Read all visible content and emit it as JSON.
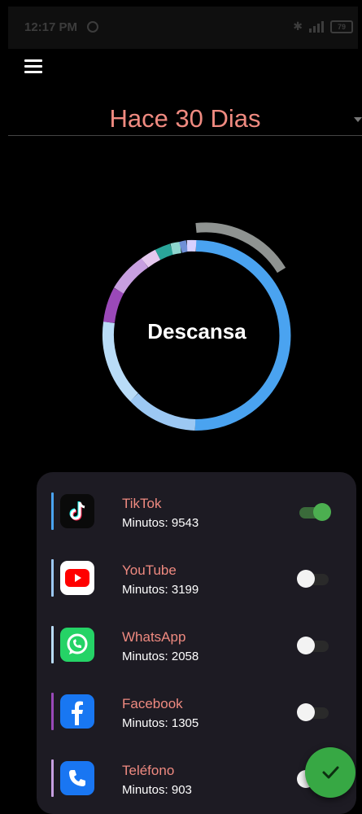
{
  "status_bar": {
    "time": "12:17 PM",
    "battery": "79"
  },
  "header": {
    "menu_icon": "hamburger-menu-icon"
  },
  "range_selector": {
    "label": "Hace 30 Dias"
  },
  "donut": {
    "center_label": "Descansa"
  },
  "apps": [
    {
      "name": "TikTok",
      "minutes": "Minutos: 9543",
      "enabled": true,
      "icon": "tiktok-icon",
      "accent": "#4aa3f0"
    },
    {
      "name": "YouTube",
      "minutes": "Minutos: 3199",
      "enabled": false,
      "icon": "youtube-icon",
      "accent": "#9cc8f3"
    },
    {
      "name": "WhatsApp",
      "minutes": "Minutos: 2058",
      "enabled": false,
      "icon": "whatsapp-icon",
      "accent": "#b9dcf7"
    },
    {
      "name": "Facebook",
      "minutes": "Minutos: 1305",
      "enabled": false,
      "icon": "facebook-icon",
      "accent": "#9a49b8"
    },
    {
      "name": "Teléfono",
      "minutes": "Minutos: 903",
      "enabled": false,
      "icon": "phone-icon",
      "accent": "#c79fe0"
    }
  ],
  "fab": {
    "icon": "check-icon"
  },
  "colors": {
    "accent_text": "#ef8a80",
    "panel": "#1d1b23",
    "toggle_on": "#4caf50",
    "fab": "#37a844"
  }
}
